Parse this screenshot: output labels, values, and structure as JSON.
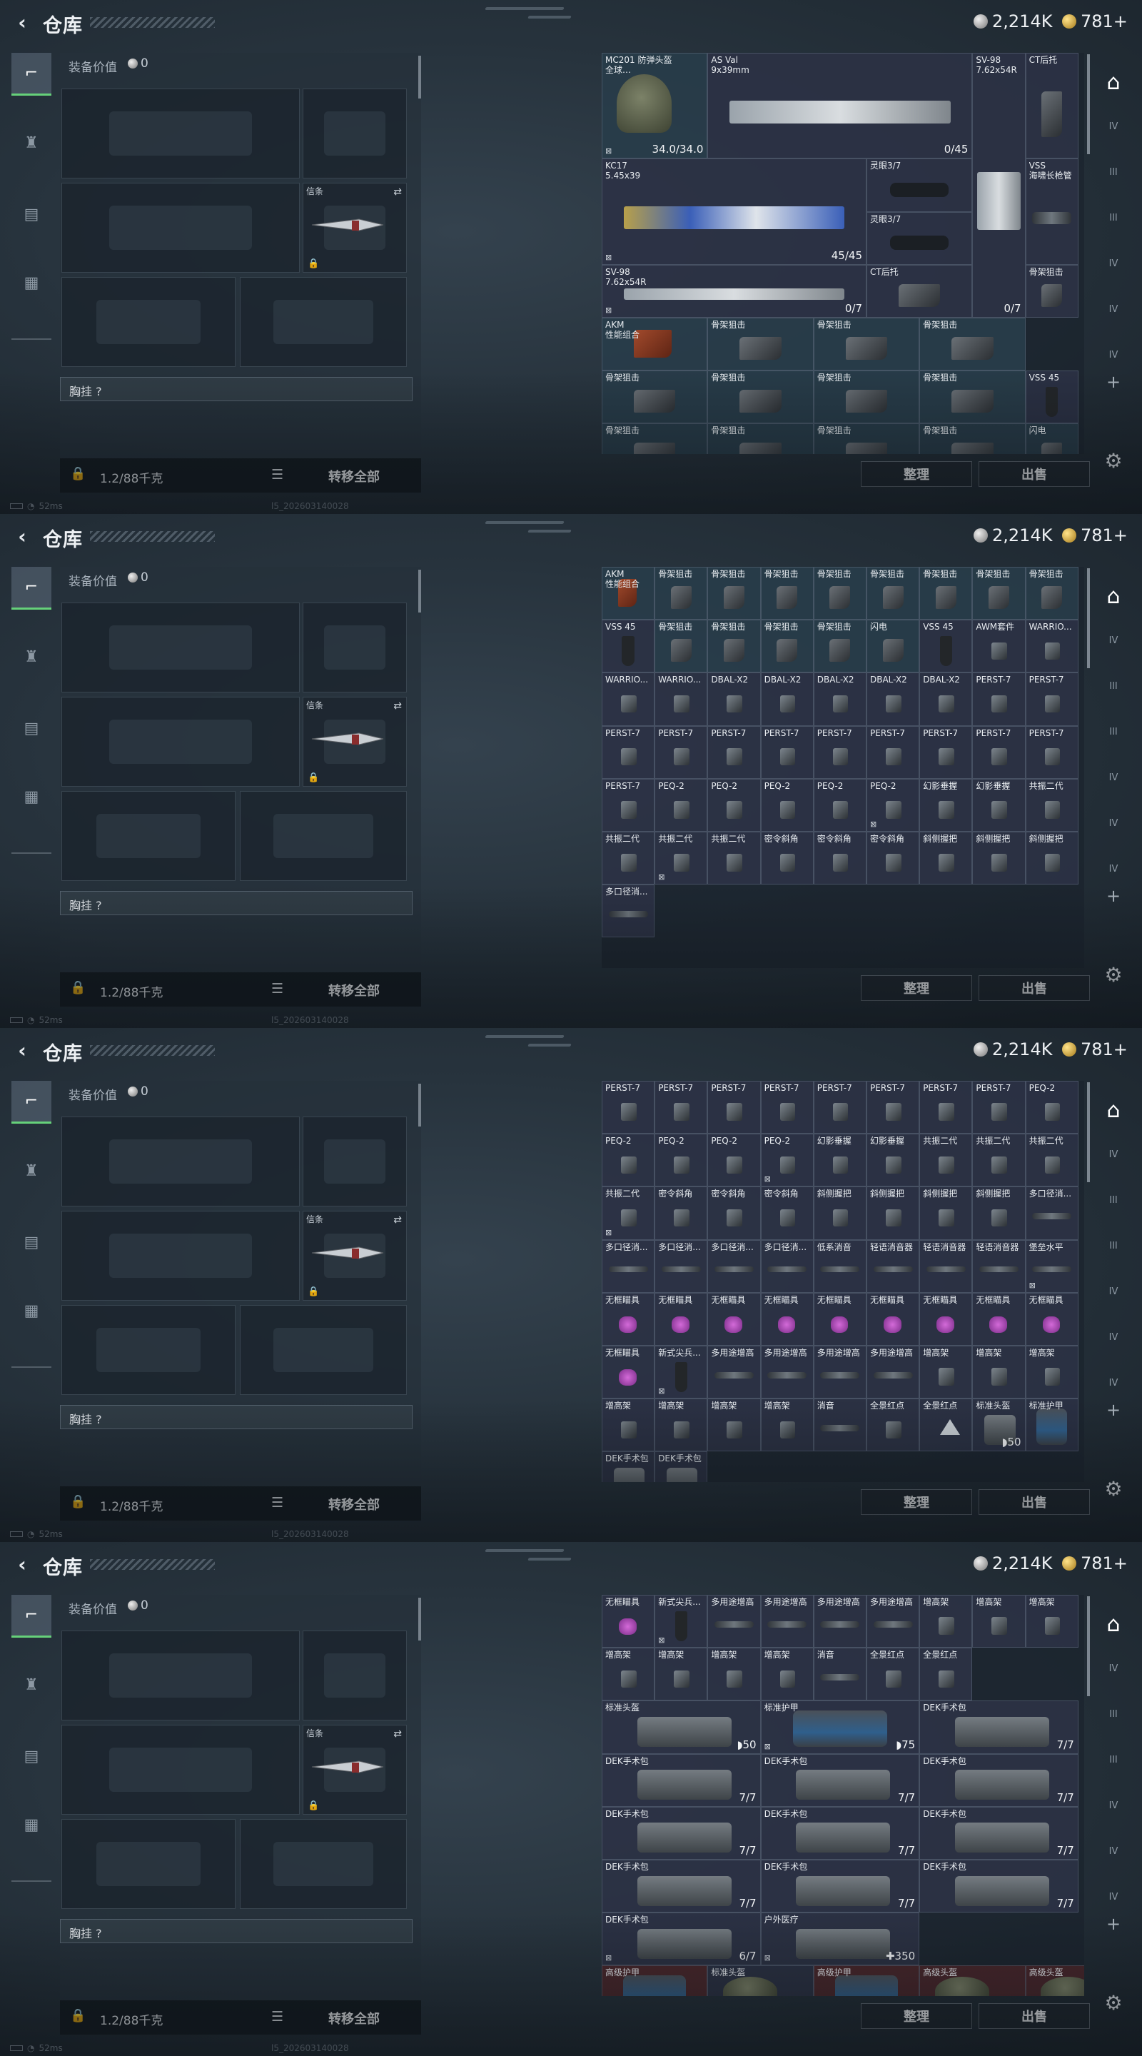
{
  "header": {
    "title": "仓库",
    "silver": "2,214K",
    "gold": "781+"
  },
  "loadout": {
    "equip_label": "装备价值",
    "equip_value": "0",
    "melee_label": "信条",
    "chest_label": "胸挂 ?",
    "weight": "1.2/88千克",
    "transfer_label": "转移全部"
  },
  "status": {
    "ping": "52ms",
    "build": "l5_202603140028"
  },
  "buttons": {
    "sort": "整理",
    "sell": "出售"
  },
  "icons": {
    "back": "chevron-left-icon",
    "silver": "silver-coin-icon",
    "gold": "gold-coin-icon",
    "tab1": "pistol-icon",
    "tab2": "helmet-badge-icon",
    "tab3": "clipboard-icon",
    "tab4": "briefcase-icon",
    "lock": "lock-icon",
    "list": "list-icon",
    "swap": "swap-icon",
    "gear": "gear-icon",
    "rail_active": "arch-icon",
    "rail_plus": "plus-icon"
  },
  "rail": {
    "labels": [
      "IV",
      "III",
      "III",
      "IV",
      "IV",
      "IV"
    ],
    "plus": "+"
  },
  "colors": {
    "accent_green": "#66d17a",
    "cell": "#363a54",
    "teal": "#2e4a58",
    "red": "#6e2828"
  },
  "frames": [
    {
      "cells": [
        {
          "name": "MC201 防弹头盔\n全球…",
          "art": "helm",
          "qty": "34.0/34.0",
          "tag": "⊠",
          "teal": true
        },
        {
          "name": "AS Val\n9x39mm",
          "art": "gun",
          "qty": "0/45"
        },
        {
          "name": "SV-98\n7.62x54R",
          "art": "gun",
          "qty": "0/7"
        },
        {
          "name": "CT后托",
          "art": "stock"
        },
        {
          "name": "KC17\n5.45x39",
          "art": "gun-blue",
          "qty": "45/45",
          "tag": "⊠"
        },
        {
          "name": "灵眼3/7",
          "art": "scope"
        },
        {
          "name": "灵眼3/7",
          "art": "scope"
        },
        {
          "name": "VSS\n海啸长枪管",
          "art": "sup"
        },
        {
          "name": "SV-98\n7.62x54R",
          "art": "gun",
          "qty": "0/7",
          "tag": "⊠"
        },
        {
          "name": "CT后托",
          "art": "stock"
        },
        {
          "name": "骨架狙击",
          "art": "stock"
        },
        {
          "name": "AKM\n性能组合",
          "art": "rust",
          "teal": true
        },
        {
          "name": "骨架狙击",
          "art": "stock",
          "teal": true
        },
        {
          "name": "骨架狙击",
          "art": "stock",
          "teal": true
        },
        {
          "name": "骨架狙击",
          "art": "stock",
          "teal": true
        },
        {
          "name": "骨架狙击",
          "art": "stock",
          "teal": true
        },
        {
          "name": "骨架狙击",
          "art": "stock",
          "teal": true
        },
        {
          "name": "骨架狙击",
          "art": "stock",
          "teal": true
        },
        {
          "name": "骨架狙击",
          "art": "stock",
          "teal": true
        },
        {
          "name": "VSS 45",
          "art": "mag"
        },
        {
          "name": "骨架狙击",
          "art": "stock",
          "teal": true
        },
        {
          "name": "骨架狙击",
          "art": "stock",
          "teal": true
        },
        {
          "name": "骨架狙击",
          "art": "stock",
          "teal": true
        },
        {
          "name": "骨架狙击",
          "art": "stock",
          "teal": true
        },
        {
          "name": "闪电",
          "art": "stock",
          "teal": true
        }
      ]
    },
    {
      "cells": [
        {
          "name": "AKM\n性能组合",
          "art": "rust",
          "teal": true
        },
        {
          "name": "骨架狙击",
          "art": "stock",
          "teal": true
        },
        {
          "name": "骨架狙击",
          "art": "stock",
          "teal": true
        },
        {
          "name": "骨架狙击",
          "art": "stock",
          "teal": true
        },
        {
          "name": "骨架狙击",
          "art": "stock",
          "teal": true
        },
        {
          "name": "骨架狙击",
          "art": "stock",
          "teal": true
        },
        {
          "name": "骨架狙击",
          "art": "stock",
          "teal": true
        },
        {
          "name": "骨架狙击",
          "art": "stock",
          "teal": true
        },
        {
          "name": "骨架狙击",
          "art": "stock",
          "teal": true
        },
        {
          "name": "VSS 45",
          "art": "mag"
        },
        {
          "name": "骨架狙击",
          "art": "stock",
          "teal": true
        },
        {
          "name": "骨架狙击",
          "art": "stock",
          "teal": true
        },
        {
          "name": "骨架狙击",
          "art": "stock",
          "teal": true
        },
        {
          "name": "骨架狙击",
          "art": "stock",
          "teal": true
        },
        {
          "name": "闪电",
          "art": "stock",
          "teal": true
        },
        {
          "name": "VSS 45",
          "art": "mag"
        },
        {
          "name": "AWM套件",
          "art": "small"
        },
        {
          "name": "WARRIO...",
          "art": "small"
        },
        {
          "name": "WARRIO...",
          "art": "small"
        },
        {
          "name": "WARRIO...",
          "art": "small"
        },
        {
          "name": "DBAL-X2",
          "art": "small"
        },
        {
          "name": "DBAL-X2",
          "art": "small"
        },
        {
          "name": "DBAL-X2",
          "art": "small"
        },
        {
          "name": "DBAL-X2",
          "art": "small"
        },
        {
          "name": "DBAL-X2",
          "art": "small"
        },
        {
          "name": "PERST-7",
          "art": "small"
        },
        {
          "name": "PERST-7",
          "art": "small"
        },
        {
          "name": "PERST-7",
          "art": "small"
        },
        {
          "name": "PERST-7",
          "art": "small"
        },
        {
          "name": "PERST-7",
          "art": "small"
        },
        {
          "name": "PERST-7",
          "art": "small"
        },
        {
          "name": "PERST-7",
          "art": "small"
        },
        {
          "name": "PERST-7",
          "art": "small"
        },
        {
          "name": "PERST-7",
          "art": "small"
        },
        {
          "name": "PERST-7",
          "art": "small"
        },
        {
          "name": "PERST-7",
          "art": "small"
        },
        {
          "name": "PERST-7",
          "art": "small"
        },
        {
          "name": "PEQ-2",
          "art": "small"
        },
        {
          "name": "PEQ-2",
          "art": "small"
        },
        {
          "name": "PEQ-2",
          "art": "small"
        },
        {
          "name": "PEQ-2",
          "art": "small"
        },
        {
          "name": "PEQ-2",
          "art": "small",
          "tag": "⊠"
        },
        {
          "name": "幻影垂握",
          "art": "small"
        },
        {
          "name": "幻影垂握",
          "art": "small"
        },
        {
          "name": "共振二代",
          "art": "small"
        },
        {
          "name": "共振二代",
          "art": "small"
        },
        {
          "name": "共振二代",
          "art": "small",
          "tag": "⊠"
        },
        {
          "name": "共振二代",
          "art": "small"
        },
        {
          "name": "密令斜角",
          "art": "small"
        },
        {
          "name": "密令斜角",
          "art": "small"
        },
        {
          "name": "密令斜角",
          "art": "small"
        },
        {
          "name": "斜侧握把",
          "art": "small"
        },
        {
          "name": "斜侧握把",
          "art": "small"
        },
        {
          "name": "斜侧握把",
          "art": "small"
        },
        {
          "name": "多口径消...",
          "art": "sup"
        }
      ]
    },
    {
      "cells": [
        {
          "name": "PERST-7",
          "art": "small"
        },
        {
          "name": "PERST-7",
          "art": "small"
        },
        {
          "name": "PERST-7",
          "art": "small"
        },
        {
          "name": "PERST-7",
          "art": "small"
        },
        {
          "name": "PERST-7",
          "art": "small"
        },
        {
          "name": "PERST-7",
          "art": "small"
        },
        {
          "name": "PERST-7",
          "art": "small"
        },
        {
          "name": "PERST-7",
          "art": "small"
        },
        {
          "name": "PEQ-2",
          "art": "small"
        },
        {
          "name": "PEQ-2",
          "art": "small"
        },
        {
          "name": "PEQ-2",
          "art": "small"
        },
        {
          "name": "PEQ-2",
          "art": "small"
        },
        {
          "name": "PEQ-2",
          "art": "small",
          "tag": "⊠"
        },
        {
          "name": "幻影垂握",
          "art": "small"
        },
        {
          "name": "幻影垂握",
          "art": "small"
        },
        {
          "name": "共振二代",
          "art": "small"
        },
        {
          "name": "共振二代",
          "art": "small"
        },
        {
          "name": "共振二代",
          "art": "small"
        },
        {
          "name": "共振二代",
          "art": "small",
          "tag": "⊠"
        },
        {
          "name": "密令斜角",
          "art": "small"
        },
        {
          "name": "密令斜角",
          "art": "small"
        },
        {
          "name": "密令斜角",
          "art": "small"
        },
        {
          "name": "斜侧握把",
          "art": "small"
        },
        {
          "name": "斜侧握把",
          "art": "small"
        },
        {
          "name": "斜侧握把",
          "art": "small"
        },
        {
          "name": "斜侧握把",
          "art": "small"
        },
        {
          "name": "多口径消...",
          "art": "sup"
        },
        {
          "name": "多口径消...",
          "art": "sup"
        },
        {
          "name": "多口径消...",
          "art": "sup"
        },
        {
          "name": "多口径消...",
          "art": "sup"
        },
        {
          "name": "多口径消...",
          "art": "sup"
        },
        {
          "name": "低系消音",
          "art": "sup"
        },
        {
          "name": "轻语消音器",
          "art": "sup"
        },
        {
          "name": "轻语消音器",
          "art": "sup"
        },
        {
          "name": "轻语消音器",
          "art": "sup"
        },
        {
          "name": "堡垒水平",
          "art": "sup",
          "tag": "⊠"
        },
        {
          "name": "无框瞄具",
          "art": "pink"
        },
        {
          "name": "无框瞄具",
          "art": "pink"
        },
        {
          "name": "无框瞄具",
          "art": "pink"
        },
        {
          "name": "无框瞄具",
          "art": "pink"
        },
        {
          "name": "无框瞄具",
          "art": "pink"
        },
        {
          "name": "无框瞄具",
          "art": "pink"
        },
        {
          "name": "无框瞄具",
          "art": "pink"
        },
        {
          "name": "无框瞄具",
          "art": "pink"
        },
        {
          "name": "无框瞄具",
          "art": "pink"
        },
        {
          "name": "无框瞄具",
          "art": "pink"
        },
        {
          "name": "新式尖兵...",
          "art": "mag",
          "tag": "⊠"
        },
        {
          "name": "多用途增高",
          "art": "sup"
        },
        {
          "name": "多用途增高",
          "art": "sup"
        },
        {
          "name": "多用途增高",
          "art": "sup"
        },
        {
          "name": "多用途增高",
          "art": "sup"
        },
        {
          "name": "增高架",
          "art": "small"
        },
        {
          "name": "增高架",
          "art": "small"
        },
        {
          "name": "增高架",
          "art": "small"
        },
        {
          "name": "增高架",
          "art": "small"
        },
        {
          "name": "增高架",
          "art": "small"
        },
        {
          "name": "增高架",
          "art": "small"
        },
        {
          "name": "增高架",
          "art": "small"
        },
        {
          "name": "消音",
          "art": "sup"
        },
        {
          "name": "全景红点",
          "art": "small"
        },
        {
          "name": "全景红点",
          "art": "tri"
        },
        {
          "name": "标准头盔",
          "art": "kit",
          "qty": "◗50"
        },
        {
          "name": "标准护甲",
          "art": "vest"
        },
        {
          "name": "DEK手术包",
          "art": "kit"
        },
        {
          "name": "DEK手术包",
          "art": "kit"
        }
      ]
    },
    {
      "cells": [
        {
          "name": "无框瞄具",
          "art": "pink"
        },
        {
          "name": "新式尖兵...",
          "art": "mag",
          "tag": "⊠"
        },
        {
          "name": "多用途增高",
          "art": "sup"
        },
        {
          "name": "多用途增高",
          "art": "sup"
        },
        {
          "name": "多用途增高",
          "art": "sup"
        },
        {
          "name": "多用途增高",
          "art": "sup"
        },
        {
          "name": "增高架",
          "art": "small"
        },
        {
          "name": "增高架",
          "art": "small"
        },
        {
          "name": "增高架",
          "art": "small"
        },
        {
          "name": "增高架",
          "art": "small"
        },
        {
          "name": "增高架",
          "art": "small"
        },
        {
          "name": "增高架",
          "art": "small"
        },
        {
          "name": "增高架",
          "art": "small"
        },
        {
          "name": "消音",
          "art": "sup"
        },
        {
          "name": "全景红点",
          "art": "small"
        },
        {
          "name": "全景红点",
          "art": "small"
        },
        {
          "name": "标准头盔",
          "art": "kit",
          "qty": "◗50"
        },
        {
          "name": "标准护甲",
          "art": "vest",
          "qty": "◗75",
          "tag": "⊠"
        },
        {
          "name": "DEK手术包",
          "art": "kit",
          "qty": "7/7"
        },
        {
          "name": "DEK手术包",
          "art": "kit",
          "qty": "7/7"
        },
        {
          "name": "DEK手术包",
          "art": "kit",
          "qty": "7/7"
        },
        {
          "name": "DEK手术包",
          "art": "kit",
          "qty": "7/7"
        },
        {
          "name": "DEK手术包",
          "art": "kit",
          "qty": "7/7"
        },
        {
          "name": "DEK手术包",
          "art": "kit",
          "qty": "7/7"
        },
        {
          "name": "DEK手术包",
          "art": "kit",
          "qty": "7/7"
        },
        {
          "name": "DEK手术包",
          "art": "kit",
          "qty": "7/7"
        },
        {
          "name": "DEK手术包",
          "art": "kit",
          "qty": "7/7"
        },
        {
          "name": "DEK手术包",
          "art": "kit",
          "qty": "7/7"
        },
        {
          "name": "DEK手术包",
          "art": "kit",
          "qty": "6/7",
          "tag": "⊠"
        },
        {
          "name": "户外医疗",
          "art": "kit",
          "qty": "✚350",
          "tag": "⊠"
        },
        {
          "name": "高级护甲",
          "art": "vest",
          "red": true
        },
        {
          "name": "标准头盔",
          "art": "helm"
        },
        {
          "name": "高级护甲",
          "art": "vest",
          "red": true
        },
        {
          "name": "高级头盔",
          "art": "helm",
          "red": true
        },
        {
          "name": "高级头盔",
          "art": "helm",
          "red": true
        }
      ]
    }
  ]
}
